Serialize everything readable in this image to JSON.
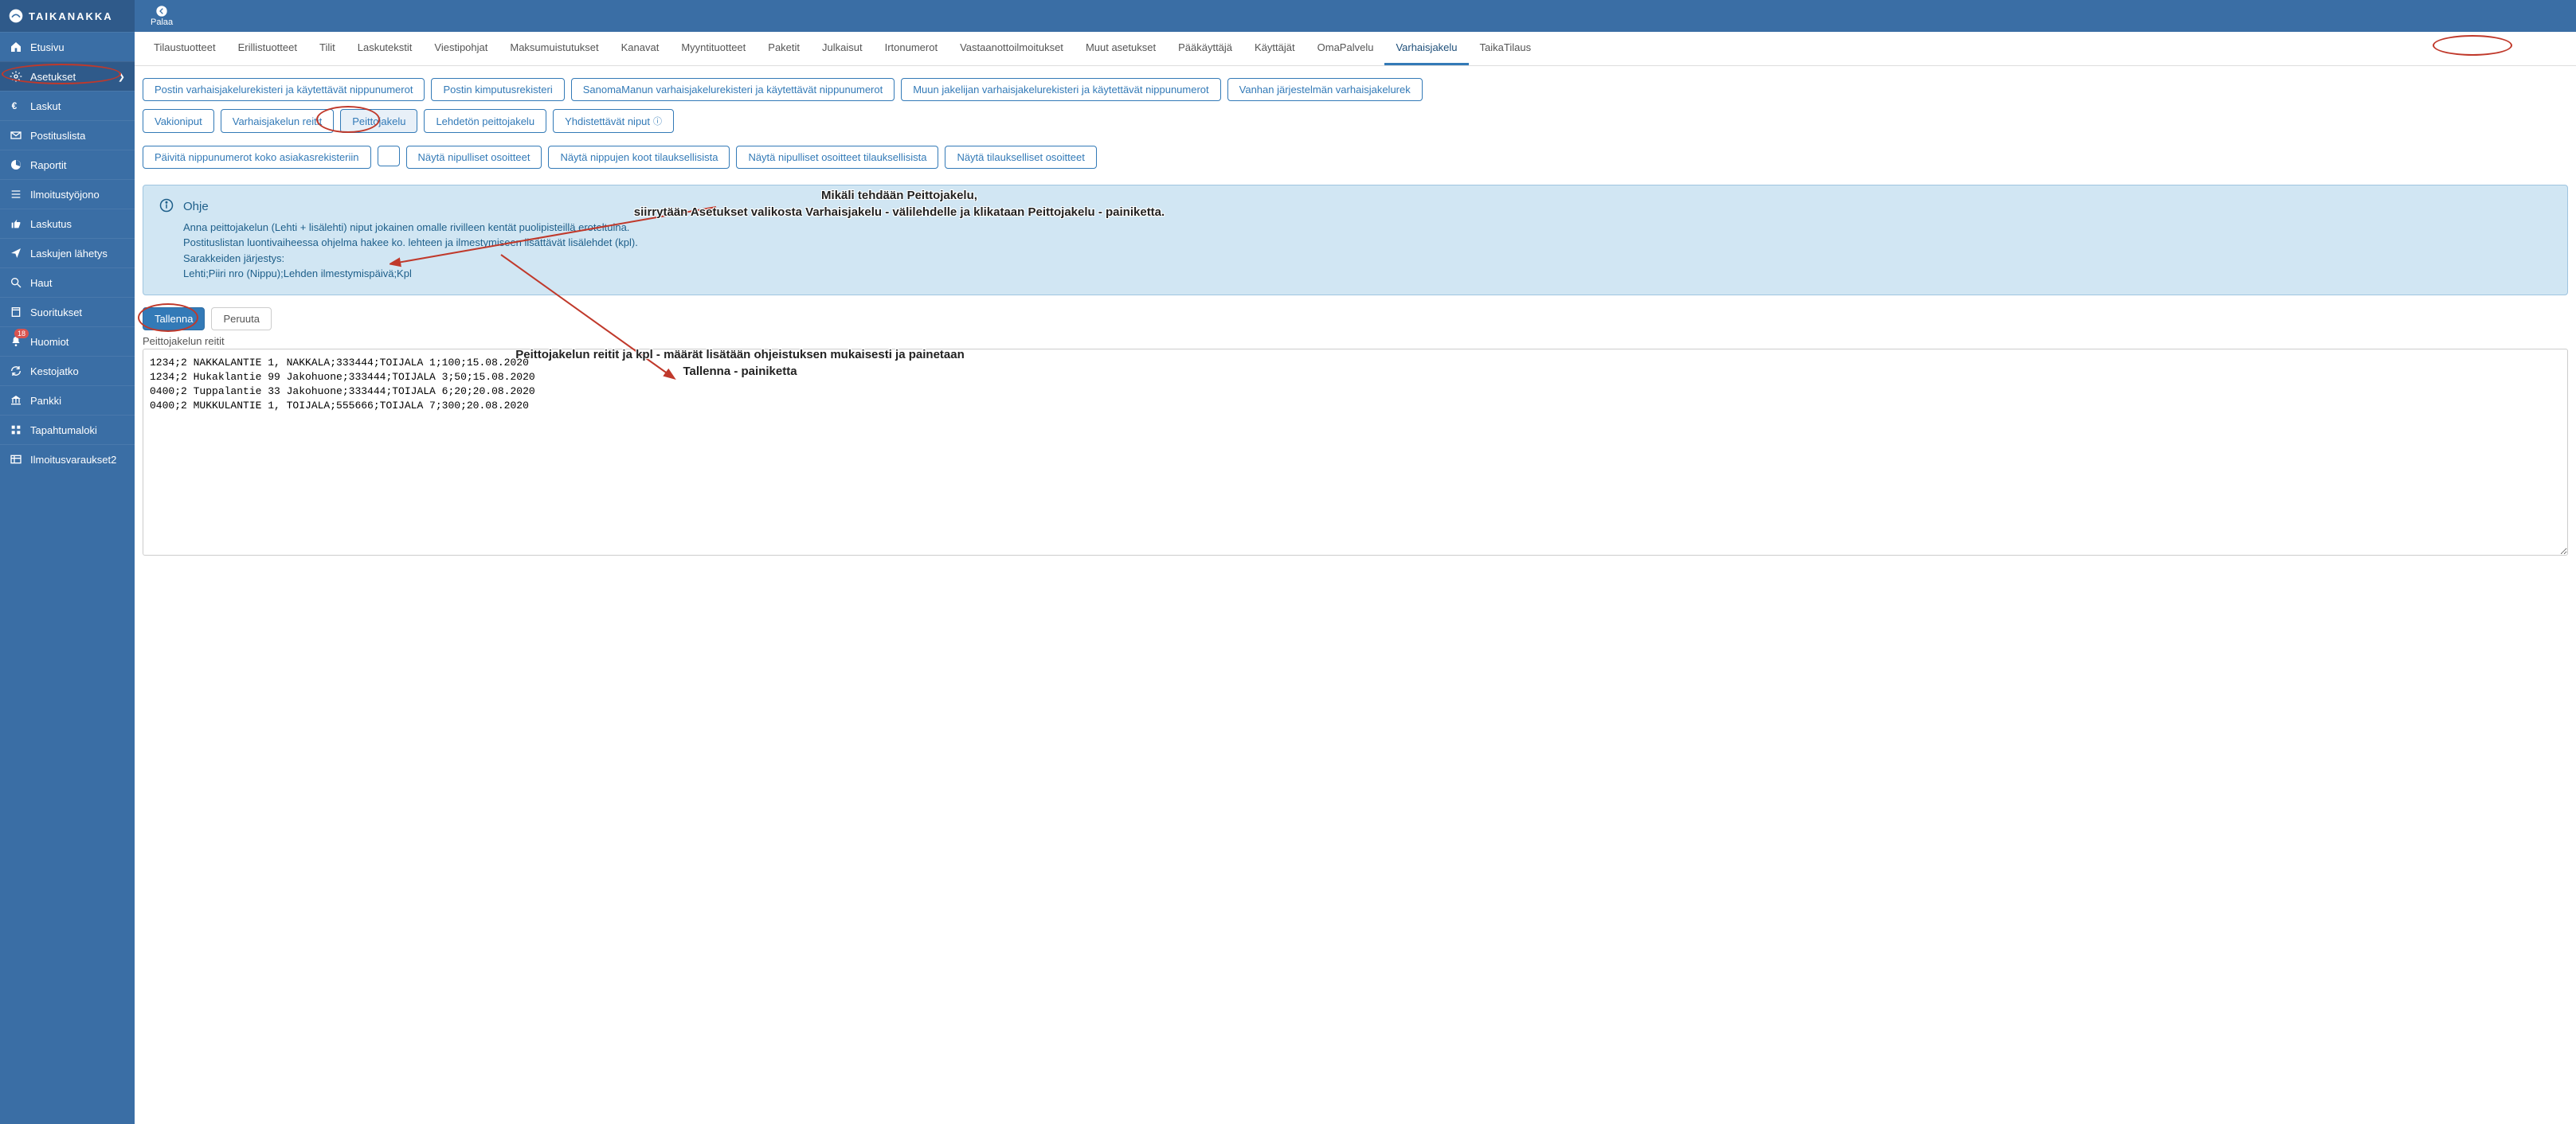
{
  "brand": "TAIKANAKKA",
  "back_label": "Palaa",
  "sidebar": [
    {
      "key": "home",
      "label": "Etusivu",
      "icon": "home"
    },
    {
      "key": "settings",
      "label": "Asetukset",
      "icon": "gear",
      "active": true,
      "chevron": true
    },
    {
      "key": "invoices",
      "label": "Laskut",
      "icon": "euro"
    },
    {
      "key": "mailinglist",
      "label": "Postituslista",
      "icon": "envelope"
    },
    {
      "key": "reports",
      "label": "Raportit",
      "icon": "pie"
    },
    {
      "key": "queue",
      "label": "Ilmoitustyöjono",
      "icon": "list"
    },
    {
      "key": "billing",
      "label": "Laskutus",
      "icon": "thumb"
    },
    {
      "key": "send",
      "label": "Laskujen lähetys",
      "icon": "send"
    },
    {
      "key": "search",
      "label": "Haut",
      "icon": "search"
    },
    {
      "key": "perf",
      "label": "Suoritukset",
      "icon": "book"
    },
    {
      "key": "notes",
      "label": "Huomiot",
      "icon": "bell",
      "badge": "18"
    },
    {
      "key": "renew",
      "label": "Kestojatko",
      "icon": "refresh"
    },
    {
      "key": "bank",
      "label": "Pankki",
      "icon": "bank"
    },
    {
      "key": "log",
      "label": "Tapahtumaloki",
      "icon": "grid"
    },
    {
      "key": "res2",
      "label": "Ilmoitusvaraukset2",
      "icon": "table"
    }
  ],
  "tabs": [
    "Tilaustuotteet",
    "Erillistuotteet",
    "Tilit",
    "Laskutekstit",
    "Viestipohjat",
    "Maksumuistutukset",
    "Kanavat",
    "Myyntituotteet",
    "Paketit",
    "Julkaisut",
    "Irtonumerot",
    "Vastaanottoilmoitukset",
    "Muut asetukset",
    "Pääkäyttäjä",
    "Käyttäjät",
    "OmaPalvelu",
    "Varhaisjakelu",
    "TaikaTilaus"
  ],
  "active_tab": 16,
  "pill_row1": [
    "Postin varhaisjakelurekisteri ja käytettävät nippunumerot",
    "Postin kimputusrekisteri",
    "SanomaManun varhaisjakelurekisteri ja käytettävät nippunumerot",
    "Muun jakelijan varhaisjakelurekisteri ja käytettävät nippunumerot",
    "Vanhan järjestelmän varhaisjakelurek"
  ],
  "pill_row2": [
    {
      "label": "Vakioniput"
    },
    {
      "label": "Varhaisjakelun reitit"
    },
    {
      "label": "Peittojakelu",
      "active": true
    },
    {
      "label": "Lehdetön peittojakelu"
    },
    {
      "label": "Yhdistettävät niput",
      "help": true
    }
  ],
  "pill_row3": [
    "Päivitä nippunumerot koko asiakasrekisteriin",
    "Näytä nipulliset osoitteet",
    "Näytä nippujen koot tilauksellisista",
    "Näytä nipulliset osoitteet tilauksellisista",
    "Näytä tilaukselliset osoitteet"
  ],
  "info": {
    "title": "Ohje",
    "lines": [
      "Anna peittojakelun (Lehti + lisälehti) niput jokainen omalle rivilleen kentät puolipisteillä eroteltuina.",
      "Postituslistan luontivaiheessa ohjelma hakee ko. lehteen ja ilmestymiseen lisättävät lisälehdet (kpl).",
      "Sarakkeiden järjestys:",
      "Lehti;Piiri nro (Nippu);Lehden ilmestymispäivä;Kpl"
    ]
  },
  "buttons": {
    "save": "Tallenna",
    "cancel": "Peruuta"
  },
  "textarea_label": "Peittojakelun reitit",
  "textarea_value": "1234;2 NAKKALANTIE 1, NAKKALA;333444;TOIJALA 1;100;15.08.2020\n1234;2 Hukaklantie 99 Jakohuone;333444;TOIJALA 3;50;15.08.2020\n0400;2 Tuppalantie 33 Jakohuone;333444;TOIJALA 6;20;20.08.2020\n0400;2 MUKKULANTIE 1, TOIJALA;555666;TOIJALA 7;300;20.08.2020",
  "annotations": {
    "a1_line1": "Mikäli tehdään Peittojakelu,",
    "a1_line2": "siirrytään Asetukset valikosta Varhaisjakelu - välilehdelle ja klikataan Peittojakelu - painiketta.",
    "a2_line1": "Peittojakelun reitit ja kpl - määrät lisätään ohjeistuksen mukaisesti ja painetaan",
    "a2_line2": "Tallenna - painiketta"
  }
}
